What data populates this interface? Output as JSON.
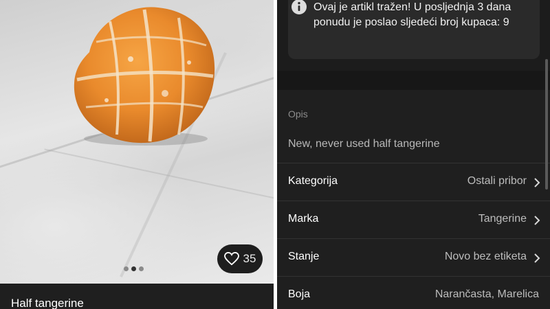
{
  "listing": {
    "title": "Half tangerine",
    "likes": "35",
    "gallery": {
      "count": 3,
      "active_index": 1
    }
  },
  "notice": {
    "icon": "info-icon",
    "text": "Ovaj je artikl tražen! U posljednja 3 dana ponudu je poslao sljedeći broj kupaca: 9"
  },
  "description": {
    "label": "Opis",
    "text": "New, never used half tangerine"
  },
  "details": [
    {
      "key": "Kategorija",
      "value": "Ostali pribor",
      "chevron": true
    },
    {
      "key": "Marka",
      "value": "Tangerine",
      "chevron": true
    },
    {
      "key": "Stanje",
      "value": "Novo bez etiketa",
      "chevron": true
    },
    {
      "key": "Boja",
      "value": "Narančasta, Marelica",
      "chevron": false
    }
  ],
  "colors": {
    "dark_bg": "#1f1f1f",
    "notice_bg": "#2a2a2a",
    "info_icon": "#dcdcdc",
    "text_primary": "#ffffff",
    "text_secondary": "#bdbdbd"
  }
}
